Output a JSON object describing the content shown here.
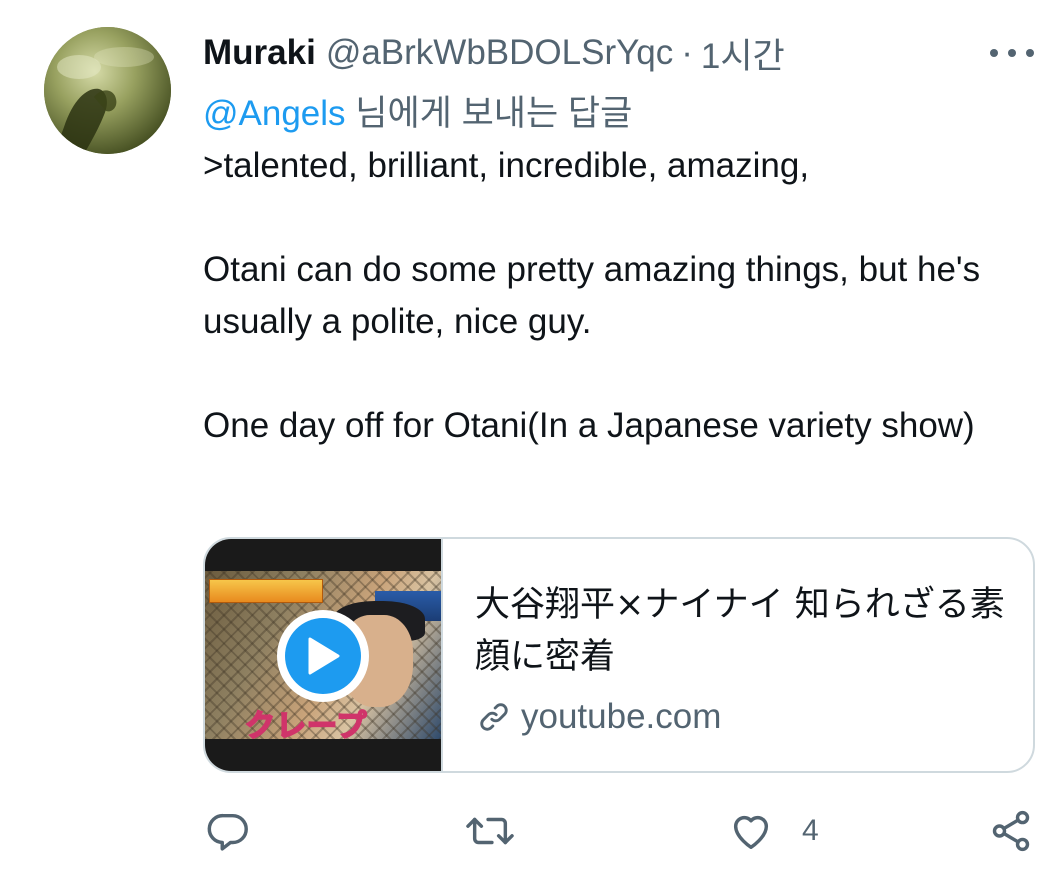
{
  "author": {
    "name": "Muraki",
    "handle": "@aBrkWbBDOLSrYqc",
    "separator": "·",
    "time": "1시간"
  },
  "reply_to": {
    "mention": "@Angels",
    "suffix": " 님에게 보내는 답글"
  },
  "body": {
    "line1": ">talented, brilliant, incredible, amazing,",
    "line2": "Otani can do some pretty amazing things, but he's usually a polite, nice guy.",
    "line3": "One day off for Otani(In a Japanese variety show)"
  },
  "card": {
    "title": "大谷翔平×ナイナイ 知られざる素顔に密着",
    "domain": "youtube.com",
    "thumbnail_caption": "クレープ"
  },
  "actions": {
    "like_count": "4"
  },
  "colors": {
    "accent": "#1d9bf0",
    "secondary_text": "#536471",
    "primary_text": "#0f1419",
    "border": "#cfd9de"
  },
  "icons": [
    "more-icon",
    "play-icon",
    "link-icon",
    "reply-icon",
    "retweet-icon",
    "like-icon",
    "share-icon"
  ]
}
